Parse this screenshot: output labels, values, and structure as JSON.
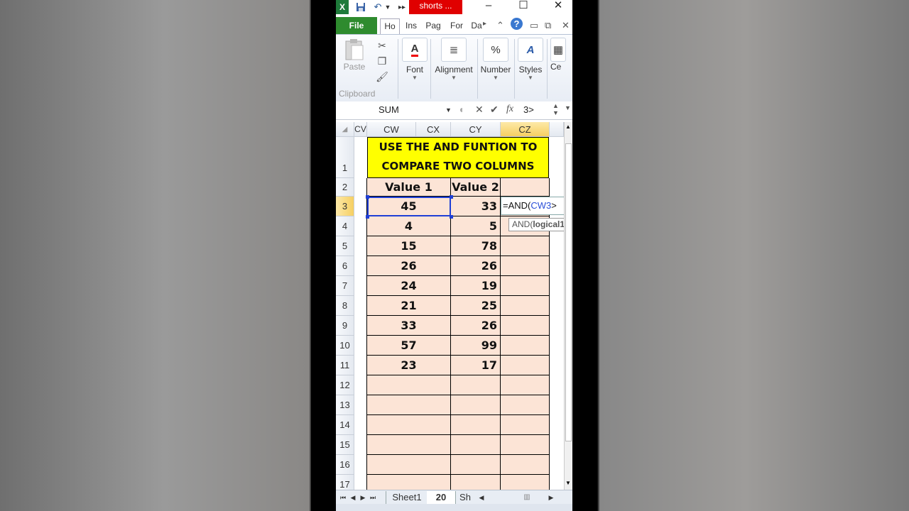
{
  "titlebar": {
    "title": "shorts ...",
    "icons": [
      "excel-logo-icon",
      "save-icon",
      "undo-icon",
      "dropdown-icon",
      "more-icon"
    ],
    "controls": {
      "minimize": "–",
      "maximize": "☐",
      "close": "✕"
    }
  },
  "ribbon_tabs": {
    "file": "File",
    "tabs": [
      "Ho",
      "Ins",
      "Pag",
      "For",
      "Da"
    ]
  },
  "ribbon": {
    "clipboard": {
      "paste": "Paste",
      "group": "Clipboard"
    },
    "font": "Font",
    "alignment": "Alignment",
    "number": "Number",
    "number_icon": "%",
    "styles": "Styles",
    "cells": "Ce"
  },
  "formula_bar": {
    "name_box": "SUM",
    "fx": "fx",
    "content": "3>"
  },
  "columns": [
    "CV",
    "CW",
    "CX",
    "CY",
    "CZ"
  ],
  "rows": [
    "1",
    "2",
    "3",
    "4",
    "5",
    "6",
    "7",
    "8",
    "9",
    "10",
    "11",
    "12",
    "13",
    "14",
    "15",
    "16",
    "17"
  ],
  "sheet": {
    "title_line1": "USE THE AND FUNTION TO",
    "title_line2": "COMPARE TWO COLUMNS",
    "header_value1": "Value 1",
    "header_value2": "Value 2",
    "values1": [
      "45",
      "4",
      "15",
      "26",
      "24",
      "21",
      "33",
      "57",
      "23"
    ],
    "values2": [
      "33",
      "5",
      "78",
      "26",
      "19",
      "25",
      "26",
      "99",
      "17"
    ],
    "editing_formula_prefix": "=AND(",
    "editing_formula_ref": "CW3",
    "editing_formula_suffix": ">",
    "tooltip_prefix": "AND(",
    "tooltip_arg": "logical1",
    "tooltip_suffix": ", ["
  },
  "sheet_tabs": {
    "tabs": [
      "Sheet1",
      "20",
      "Sh"
    ]
  },
  "colors": {
    "title_fill": "#ffff00",
    "cell_fill": "#fce4d6",
    "file_tab": "#2e8b2e",
    "title_badge": "#e00000"
  }
}
